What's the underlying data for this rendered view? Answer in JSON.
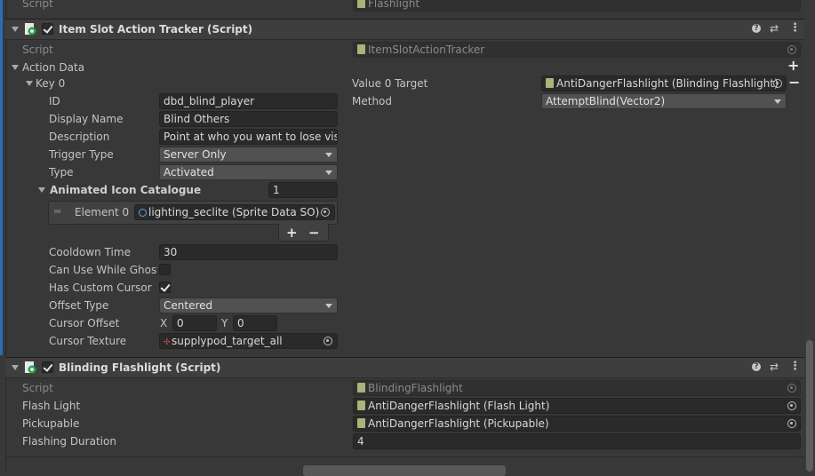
{
  "top": {
    "script_label": "Script",
    "script_value": "Flashlight"
  },
  "tracker": {
    "title": "Item Slot Action Tracker (Script)",
    "script_label": "Script",
    "script_value": "ItemSlotActionTracker",
    "action_data_label": "Action Data",
    "key0_label": "Key 0",
    "id_label": "ID",
    "id_value": "dbd_blind_player",
    "display_name_label": "Display Name",
    "display_name_value": "Blind Others",
    "description_label": "Description",
    "description_value": "Point at who you want to lose visic",
    "trigger_type_label": "Trigger Type",
    "trigger_type_value": "Server Only",
    "type_label": "Type",
    "type_value": "Activated",
    "icon_catalogue_label": "Animated Icon Catalogue",
    "icon_catalogue_count": "1",
    "element0_label": "Element 0",
    "element0_value": "lighting_seclite (Sprite Data SO)",
    "cooldown_label": "Cooldown Time",
    "cooldown_value": "30",
    "ghost_label": "Can Use While Ghosti",
    "ghost_checked": false,
    "custom_cursor_label": "Has Custom Cursor",
    "custom_cursor_checked": true,
    "offset_type_label": "Offset Type",
    "offset_type_value": "Centered",
    "cursor_offset_label": "Cursor Offset",
    "x_label": "X",
    "x_value": "0",
    "y_label": "Y",
    "y_value": "0",
    "cursor_texture_label": "Cursor Texture",
    "cursor_texture_value": "supplypod_target_all",
    "value0_target_label": "Value 0 Target",
    "value0_target_value": "AntiDangerFlashlight (Blinding Flashlight)",
    "method_label": "Method",
    "method_value": "AttemptBlind(Vector2)",
    "plus": "+",
    "minus": "−"
  },
  "blinding": {
    "title": "Blinding Flashlight (Script)",
    "script_label": "Script",
    "script_value": "BlindingFlashlight",
    "flash_light_label": "Flash Light",
    "flash_light_value": "AntiDangerFlashlight (Flash Light)",
    "pickupable_label": "Pickupable",
    "pickupable_value": "AntiDangerFlashlight (Pickupable)",
    "duration_label": "Flashing Duration",
    "duration_value": "4"
  },
  "header_icons": {
    "help": "?",
    "settings": "⇄",
    "menu": "⋮"
  },
  "colors": {
    "accent": "#2d6bb5",
    "background": "#383838",
    "field": "#2a2a2a"
  }
}
